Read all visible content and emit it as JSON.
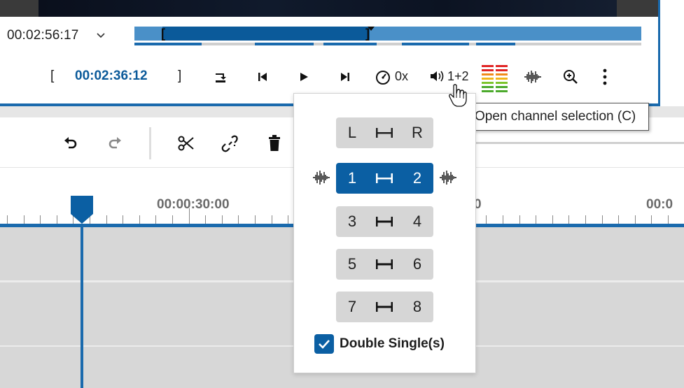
{
  "player": {
    "current_timecode": "00:02:56:17",
    "in_point_timecode": "00:02:36:12",
    "in_bracket": "[",
    "out_bracket": "]",
    "speed_label": "0x",
    "channel_label": "1+2"
  },
  "tooltip": {
    "text": "Open channel selection (C)"
  },
  "timeline": {
    "ruler_labels": [
      "00:00:30:00",
      "0",
      "00:0"
    ]
  },
  "channel_popup": {
    "rows": [
      {
        "left": "L",
        "right": "R",
        "active": false
      },
      {
        "left": "1",
        "right": "2",
        "active": true
      },
      {
        "left": "3",
        "right": "4",
        "active": false
      },
      {
        "left": "5",
        "right": "6",
        "active": false
      },
      {
        "left": "7",
        "right": "8",
        "active": false
      }
    ],
    "double_single_label": "Double Single(s)",
    "double_single_checked": true
  },
  "colors": {
    "accent": "#0b5fa3",
    "track_bg": "#d7d7d7"
  }
}
